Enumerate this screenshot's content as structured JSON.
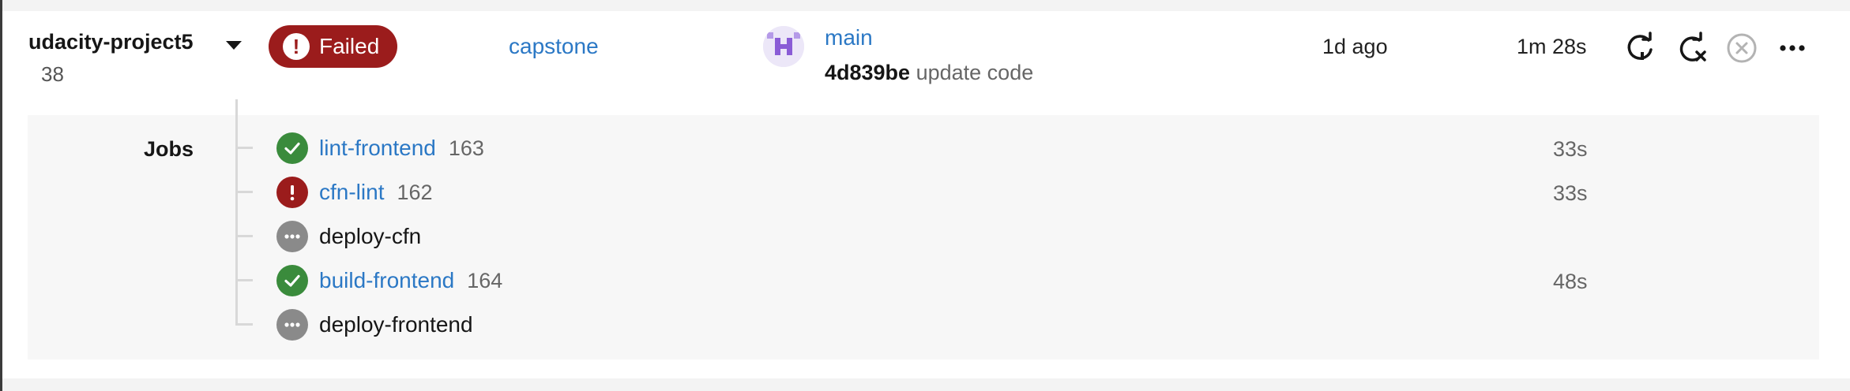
{
  "pipeline": {
    "project": "udacity-project5",
    "number": "38",
    "status": {
      "label": "Failed",
      "color": "#9b1c1c",
      "icon": "alert-icon"
    },
    "workflow": "capstone",
    "branch": "main",
    "commit": {
      "sha": "4d839be",
      "message": "update code"
    },
    "time_ago": "1d ago",
    "duration": "1m 28s",
    "actions": [
      "rerun-icon",
      "rerun-failed-icon",
      "cancel-icon",
      "more-icon"
    ]
  },
  "jobs": {
    "label": "Jobs",
    "items": [
      {
        "name": "lint-frontend",
        "number": "163",
        "duration": "33s",
        "status": "success"
      },
      {
        "name": "cfn-lint",
        "number": "162",
        "duration": "33s",
        "status": "failed"
      },
      {
        "name": "deploy-cfn",
        "number": "",
        "duration": "",
        "status": "queued"
      },
      {
        "name": "build-frontend",
        "number": "164",
        "duration": "48s",
        "status": "success"
      },
      {
        "name": "deploy-frontend",
        "number": "",
        "duration": "",
        "status": "queued"
      }
    ]
  },
  "colors": {
    "link": "#2b78c5",
    "success": "#3a8b3c",
    "failed": "#9b1c1c",
    "queued": "#8a8a8a"
  }
}
